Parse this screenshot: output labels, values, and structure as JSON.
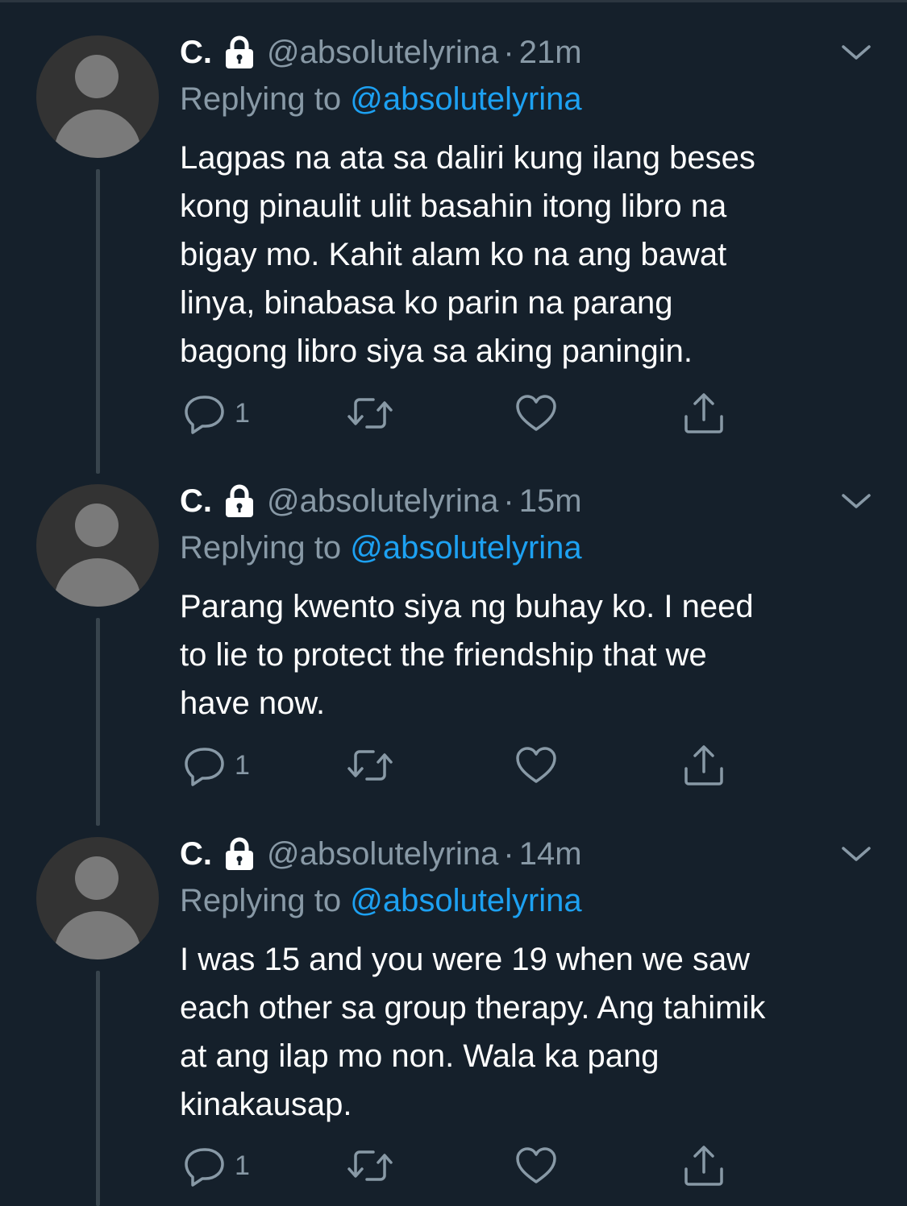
{
  "tweets": [
    {
      "name": "C.",
      "handle": "@absolutelyrina",
      "separator": "·",
      "time": "21m",
      "replying_prefix": "Replying to",
      "replying_to": "@absolutelyrina",
      "text": "Lagpas na ata sa daliri kung ilang beses\nkong pinaulit ulit basahin itong libro na\nbigay mo. Kahit alam ko na ang bawat\nlinya, binabasa ko parin na parang\nbagong libro siya sa aking paningin.",
      "reply_count": "1"
    },
    {
      "name": "C.",
      "handle": "@absolutelyrina",
      "separator": "·",
      "time": "15m",
      "replying_prefix": "Replying to",
      "replying_to": "@absolutelyrina",
      "text": "Parang kwento siya ng buhay ko. I need\nto lie to protect the friendship that we\nhave now.",
      "reply_count": "1"
    },
    {
      "name": "C.",
      "handle": "@absolutelyrina",
      "separator": "·",
      "time": "14m",
      "replying_prefix": "Replying to",
      "replying_to": "@absolutelyrina",
      "text": "I was 15 and you were 19 when we saw\neach other sa group therapy. Ang tahimik\nat ang ilap mo non. Wala ka pang\nkinakausap.",
      "reply_count": "1"
    }
  ],
  "icons": {
    "lock": "lock-icon",
    "chevron": "chevron-down-icon",
    "reply": "reply-icon",
    "retweet": "retweet-icon",
    "like": "heart-icon",
    "share": "share-icon"
  },
  "colors": {
    "background": "#15202b",
    "text_primary": "#ffffff",
    "text_secondary": "#8899a6",
    "mention": "#1da1f2",
    "thread_line": "#38444d",
    "avatar_bg": "#333333",
    "avatar_fg": "#7a7a7a"
  }
}
